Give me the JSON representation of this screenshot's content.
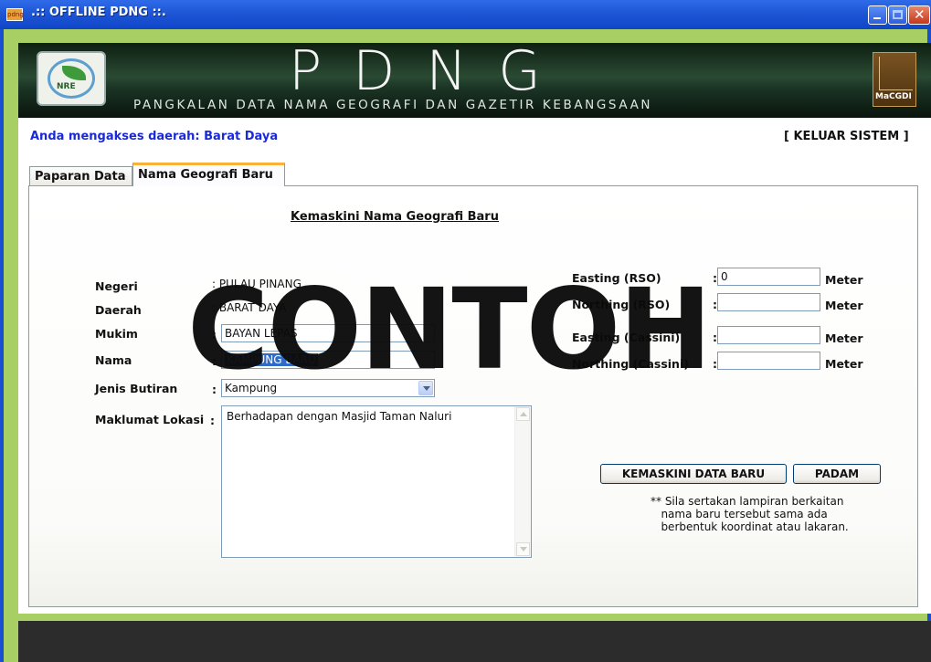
{
  "window": {
    "title": ".:: OFFLINE PDNG ::.",
    "app_icon_text": "pdng"
  },
  "banner": {
    "title": "PDNG",
    "subtitle": "PANGKALAN DATA NAMA GEOGRAFI DAN GAZETIR KEBANGSAAN",
    "logo_left_text": "NRE",
    "logo_right_text": "MaCGDI"
  },
  "header": {
    "access_text": "Anda mengakses daerah: Barat Daya",
    "logout_label": "[ KELUAR SISTEM ]"
  },
  "tabs": [
    {
      "label": "Paparan Data"
    },
    {
      "label": "Nama Geografi Baru"
    }
  ],
  "form": {
    "title": "Kemaskini Nama Geografi Baru",
    "negeri": {
      "label": "Negeri",
      "value": ": PULAU PINANG"
    },
    "daerah": {
      "label": "Daerah",
      "value": ": BARAT DAYA"
    },
    "mukim": {
      "label": "Mukim",
      "value": "BAYAN LEPAS"
    },
    "nama": {
      "label": "Nama",
      "value": "KAMPUNG BARU"
    },
    "jenis_butiran": {
      "label": "Jenis Butiran",
      "value": "Kampung"
    },
    "maklumat_lokasi": {
      "label": "Maklumat Lokasi",
      "value": "Berhadapan dengan Masjid Taman Naluri"
    },
    "colon": ":",
    "easting_rso": {
      "label": "Easting (RSO)",
      "value": "0"
    },
    "northing_rso": {
      "label": "Northing (RSO)",
      "value": ""
    },
    "easting_cassini": {
      "label": "Easting (Cassini)",
      "value": ""
    },
    "northing_cassini": {
      "label": "Northing (Cassini)",
      "value": ""
    },
    "unit": "Meter"
  },
  "buttons": {
    "update": "KEMASKINI DATA BARU",
    "delete": "PADAM"
  },
  "note": "** Sila sertakan lampiran berkaitan\n   nama baru tersebut sama ada\n   berbentuk koordinat atau lakaran.",
  "watermark": "CONTOH",
  "colors": {
    "accent_green": "#a8cf63",
    "link_blue": "#1a2ad8",
    "tab_highlight": "#f8b23a",
    "selection": "#316ac5"
  }
}
